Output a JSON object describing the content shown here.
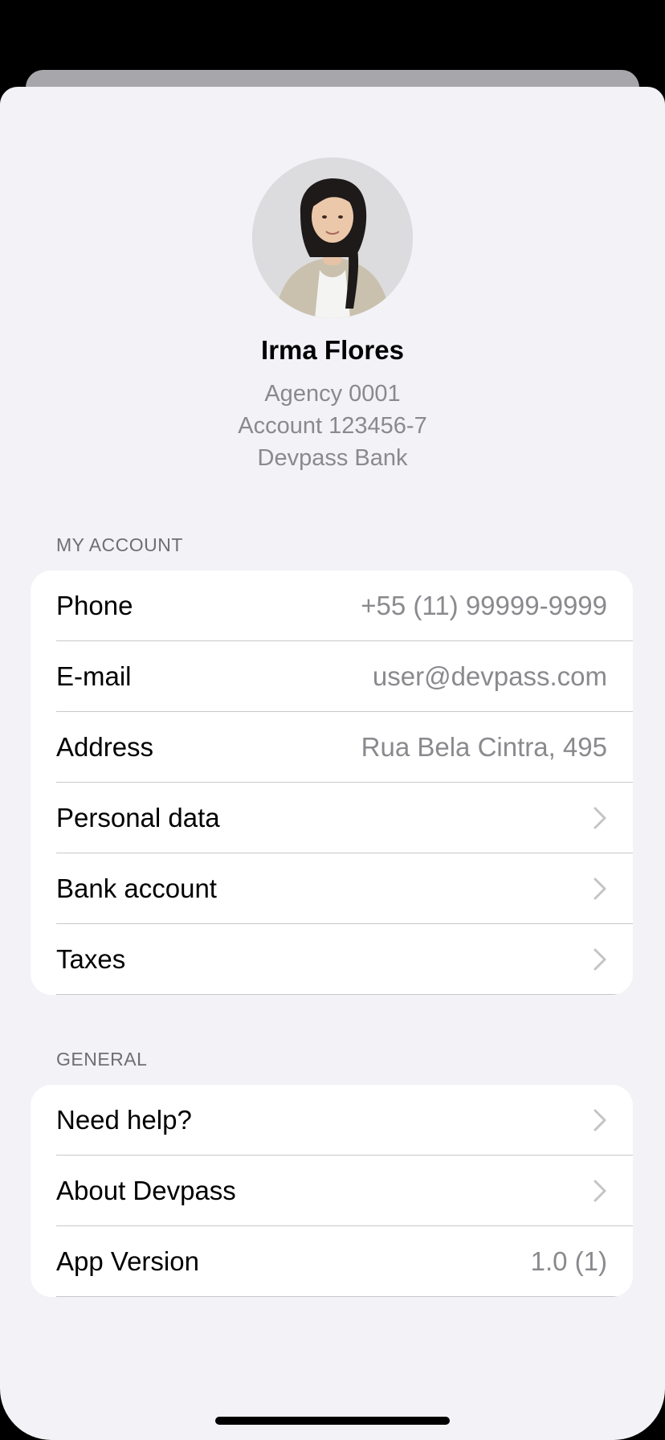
{
  "profile": {
    "name": "Irma Flores",
    "agency": "Agency 0001",
    "account": "Account 123456-7",
    "bank": "Devpass Bank"
  },
  "my_account": {
    "header": "MY ACCOUNT",
    "rows": [
      {
        "label": "Phone",
        "value": "+55 (11) 99999-9999"
      },
      {
        "label": "E-mail",
        "value": "user@devpass.com"
      },
      {
        "label": "Address",
        "value": "Rua Bela Cintra, 495"
      },
      {
        "label": "Personal data",
        "icon": "chevron-right-icon"
      },
      {
        "label": "Bank account",
        "icon": "chevron-right-icon"
      },
      {
        "label": "Taxes",
        "icon": "chevron-right-icon"
      }
    ]
  },
  "general": {
    "header": "GENERAL",
    "rows": [
      {
        "label": "Need help?",
        "icon": "chevron-right-icon"
      },
      {
        "label": "About Devpass",
        "icon": "chevron-right-icon"
      },
      {
        "label": "App Version",
        "value": "1.0 (1)"
      }
    ]
  },
  "colors": {
    "background": "#f2f2f7",
    "card": "#ffffff",
    "secondary_text": "#8a8a8e",
    "separator": "#c8c8cc"
  }
}
